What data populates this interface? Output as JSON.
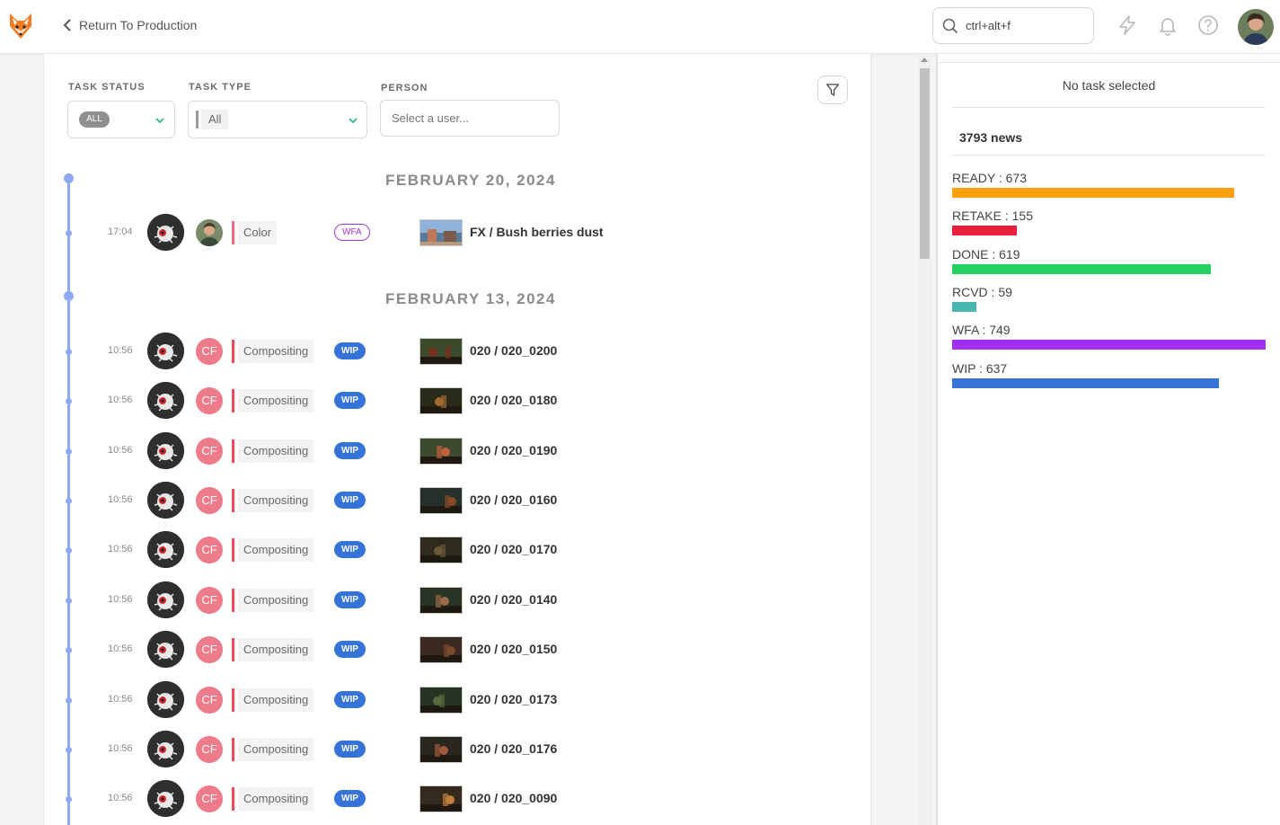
{
  "header": {
    "back_label": "Return To Production",
    "search_value": "ctrl+alt+f",
    "icons": [
      "kitsu-fox-logo",
      "lightning-icon",
      "bell-icon",
      "help-icon",
      "user-avatar"
    ]
  },
  "filters": {
    "task_status_label": "TASK STATUS",
    "task_status_value": "ALL",
    "task_type_label": "TASK TYPE",
    "task_type_value": "All",
    "person_label": "PERSON",
    "person_placeholder": "Select a user..."
  },
  "timeline": [
    {
      "date": "FEBRUARY 20, 2024",
      "entries": [
        {
          "time": "17:04",
          "assignee": "",
          "task_type": "Color",
          "type_color": "#f06b7e",
          "status": "WFA",
          "entity": "FX / Bush berries dust"
        }
      ]
    },
    {
      "date": "FEBRUARY 13, 2024",
      "entries": [
        {
          "time": "10:56",
          "assignee": "CF",
          "task_type": "Compositing",
          "type_color": "#ef4b5f",
          "status": "WIP",
          "entity": "020 / 020_0200"
        },
        {
          "time": "10:56",
          "assignee": "CF",
          "task_type": "Compositing",
          "type_color": "#ef4b5f",
          "status": "WIP",
          "entity": "020 / 020_0180"
        },
        {
          "time": "10:56",
          "assignee": "CF",
          "task_type": "Compositing",
          "type_color": "#ef4b5f",
          "status": "WIP",
          "entity": "020 / 020_0190"
        },
        {
          "time": "10:56",
          "assignee": "CF",
          "task_type": "Compositing",
          "type_color": "#ef4b5f",
          "status": "WIP",
          "entity": "020 / 020_0160"
        },
        {
          "time": "10:56",
          "assignee": "CF",
          "task_type": "Compositing",
          "type_color": "#ef4b5f",
          "status": "WIP",
          "entity": "020 / 020_0170"
        },
        {
          "time": "10:56",
          "assignee": "CF",
          "task_type": "Compositing",
          "type_color": "#ef4b5f",
          "status": "WIP",
          "entity": "020 / 020_0140"
        },
        {
          "time": "10:56",
          "assignee": "CF",
          "task_type": "Compositing",
          "type_color": "#ef4b5f",
          "status": "WIP",
          "entity": "020 / 020_0150"
        },
        {
          "time": "10:56",
          "assignee": "CF",
          "task_type": "Compositing",
          "type_color": "#ef4b5f",
          "status": "WIP",
          "entity": "020 / 020_0173"
        },
        {
          "time": "10:56",
          "assignee": "CF",
          "task_type": "Compositing",
          "type_color": "#ef4b5f",
          "status": "WIP",
          "entity": "020 / 020_0176"
        },
        {
          "time": "10:56",
          "assignee": "CF",
          "task_type": "Compositing",
          "type_color": "#ef4b5f",
          "status": "WIP",
          "entity": "020 / 020_0090"
        }
      ]
    }
  ],
  "side_panel": {
    "no_task": "No task selected",
    "news_count": "3793 news",
    "stats": [
      {
        "label": "READY : 673",
        "count": 673,
        "color": "#ffa00f"
      },
      {
        "label": "RETAKE : 155",
        "count": 155,
        "color": "#ed1e3b"
      },
      {
        "label": "DONE : 619",
        "count": 619,
        "color": "#22d160"
      },
      {
        "label": "RCVD : 59",
        "count": 59,
        "color": "#4ab6b0"
      },
      {
        "label": "WFA : 749",
        "count": 749,
        "color": "#a02ef5"
      },
      {
        "label": "WIP : 637",
        "count": 637,
        "color": "#3773d6"
      }
    ]
  }
}
